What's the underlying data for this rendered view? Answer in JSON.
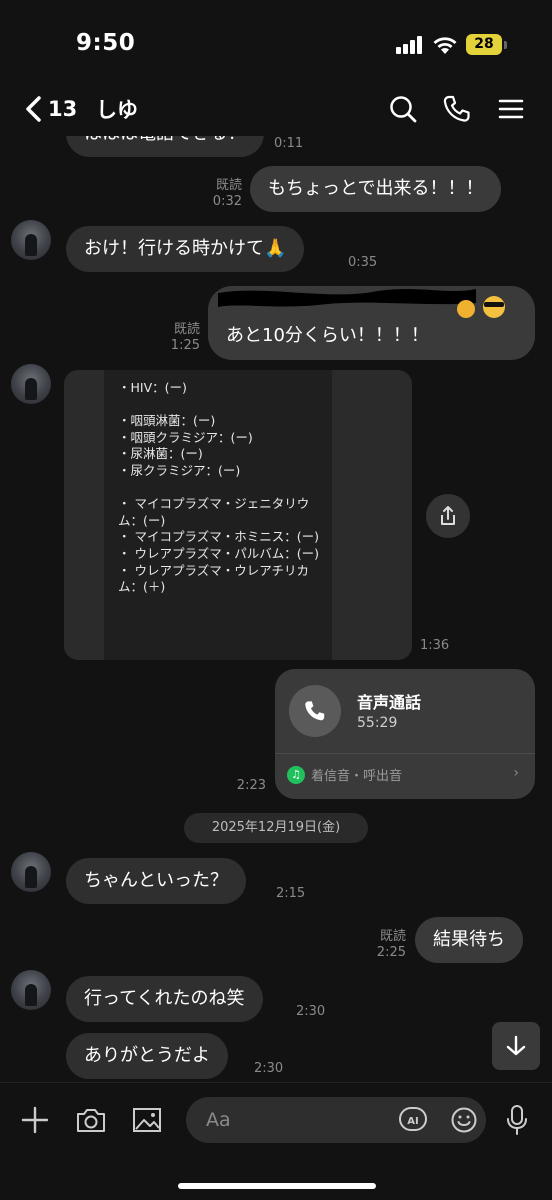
{
  "status_bar": {
    "time": "9:50",
    "battery": "28"
  },
  "header": {
    "back_count": "13",
    "title": "しゆ"
  },
  "messages": [
    {
      "text": "ははは電話できる！",
      "time": "0:11"
    },
    {
      "read": "既読",
      "time": "0:32",
      "text": "もちょっとで出来る！！！"
    },
    {
      "text": "おけ！行ける時かけて🙏",
      "time": "0:35"
    },
    {
      "read": "既読",
      "time": "1:25",
      "text": "あと10分くらい！！！！"
    },
    {
      "time": "1:36",
      "doc_text": "・HIV：(ー)\n\n・咽頭淋菌：(ー)\n・咽頭クラミジア：(ー)\n・尿淋菌：(ー)\n・尿クラミジア：(ー)\n\n・ マイコプラズマ・ジェニタリウム：(ー)\n・ マイコプラズマ・ホミニス：(ー)\n・ ウレアプラズマ・パルバム：(ー)\n・ ウレアプラズマ・ウレアチリカム：(＋)"
    },
    {
      "time": "2:23",
      "call_title": "音声通話",
      "call_duration": "55:29",
      "ringtone_label": "着信音・呼出音"
    },
    {
      "date": "2025年12月19日(金)"
    },
    {
      "text": "ちゃんといった？",
      "time": "2:15"
    },
    {
      "read": "既読",
      "time": "2:25",
      "text": "結果待ち"
    },
    {
      "text": "行ってくれたのね笑",
      "time": "2:30"
    },
    {
      "text": "ありがとうだよ",
      "time": "2:30"
    }
  ],
  "input": {
    "placeholder": "Aa"
  },
  "icons": {
    "search": "search-icon",
    "phone": "phone-icon",
    "menu": "menu-icon",
    "plus": "plus-icon",
    "camera": "camera-icon",
    "image": "image-icon",
    "ai": "ai-icon",
    "emoji": "emoji-icon",
    "mic": "mic-icon",
    "share": "share-icon",
    "scroll_down": "arrow-down-icon"
  },
  "colors": {
    "background": "#121212",
    "bubble": "#2f2f2f",
    "battery": "#e4d23b",
    "ringtone_dot": "#20c05c"
  }
}
